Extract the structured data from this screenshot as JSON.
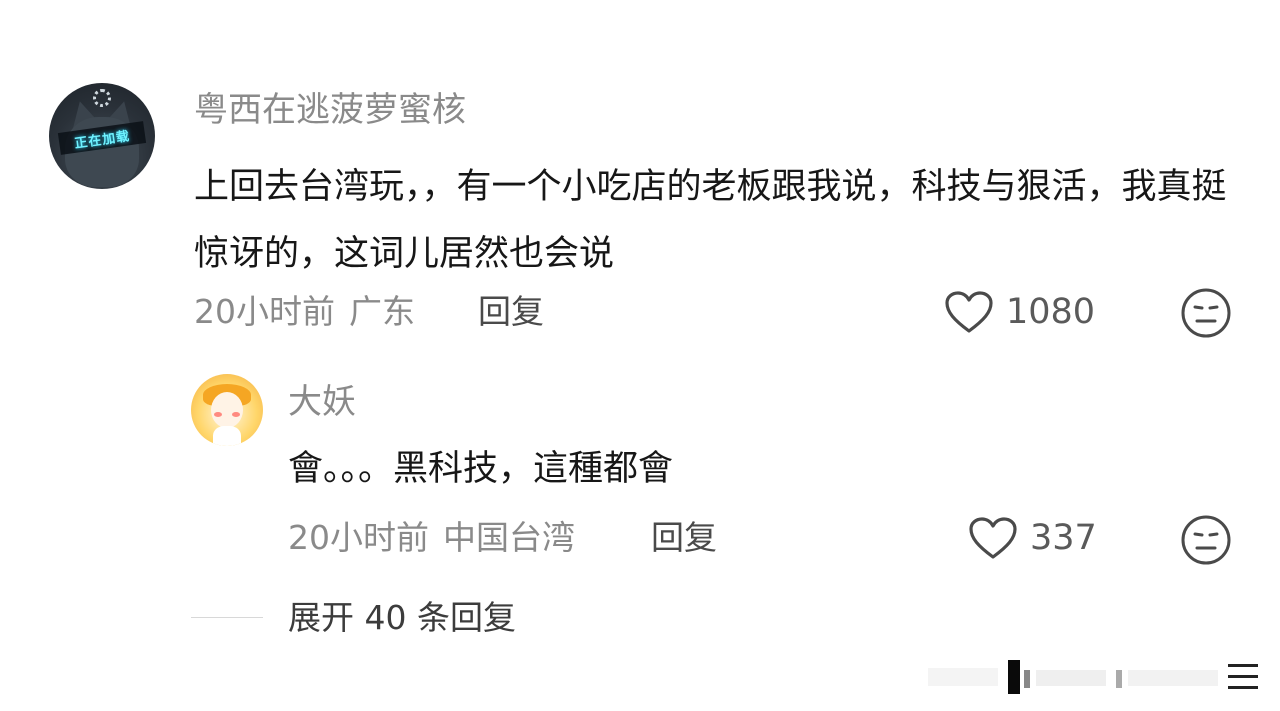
{
  "comment": {
    "username": "粤西在逃菠萝蜜核",
    "avatar_badge_text": "正在加载",
    "text": "上回去台湾玩，，有一个小吃店的老板跟我说，科技与狠活，我真挺惊讶的，这词儿居然也会说",
    "time": "20小时前",
    "location": "广东",
    "reply_label": "回复",
    "like_count": "1080"
  },
  "reply": {
    "username": "大妖",
    "text": "會。。。黑科技，這種都會",
    "time": "20小时前",
    "location": "中国台湾",
    "reply_label": "回复",
    "like_count": "337"
  },
  "expand_label": "展开 40 条回复",
  "icons": {
    "like": "heart-outline-icon",
    "dislike": "meh-face-icon",
    "watermark": "watermark-bars-icon"
  },
  "colors": {
    "name_gray": "#8a8a8a",
    "text_dark": "#171717",
    "icon_gray": "#4a4a4a",
    "avatar_badge_cyan": "#6ff2ff"
  }
}
